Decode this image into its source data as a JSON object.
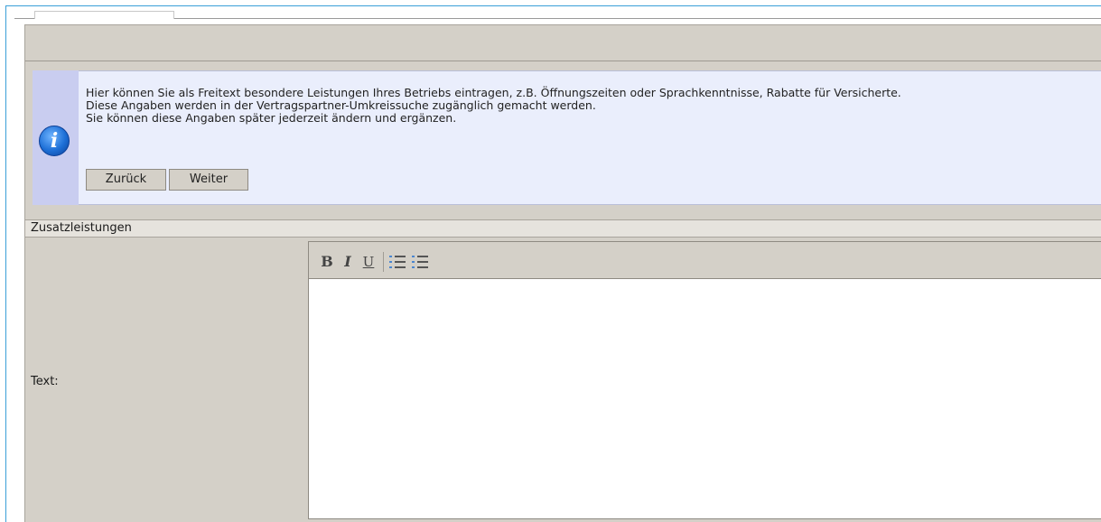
{
  "info": {
    "lines": [
      "Hier können Sie als Freitext besondere Leistungen Ihres Betriebs eintragen, z.B. Öffnungszeiten oder Sprachkenntnisse, Rabatte für Versicherte.",
      "Diese Angaben werden in der Vertragspartner-Umkreissuche zugänglich gemacht werden.",
      "Sie können diese Angaben später jederzeit ändern und ergänzen."
    ],
    "icon_glyph": "i",
    "icon": "info-icon"
  },
  "buttons": {
    "back_label": "Zurück",
    "next_label": "Weiter"
  },
  "section": {
    "title": "Zusatzleistungen",
    "field_label": "Text:"
  },
  "editor": {
    "bold": "B",
    "italic": "I",
    "underline": "U",
    "ordered_list_icon": "ordered-list-icon",
    "unordered_list_icon": "unordered-list-icon",
    "content": ""
  },
  "colors": {
    "accent_border": "#3aa0d8",
    "info_background": "#eaeefc",
    "panel_background": "#d4d0c8"
  }
}
